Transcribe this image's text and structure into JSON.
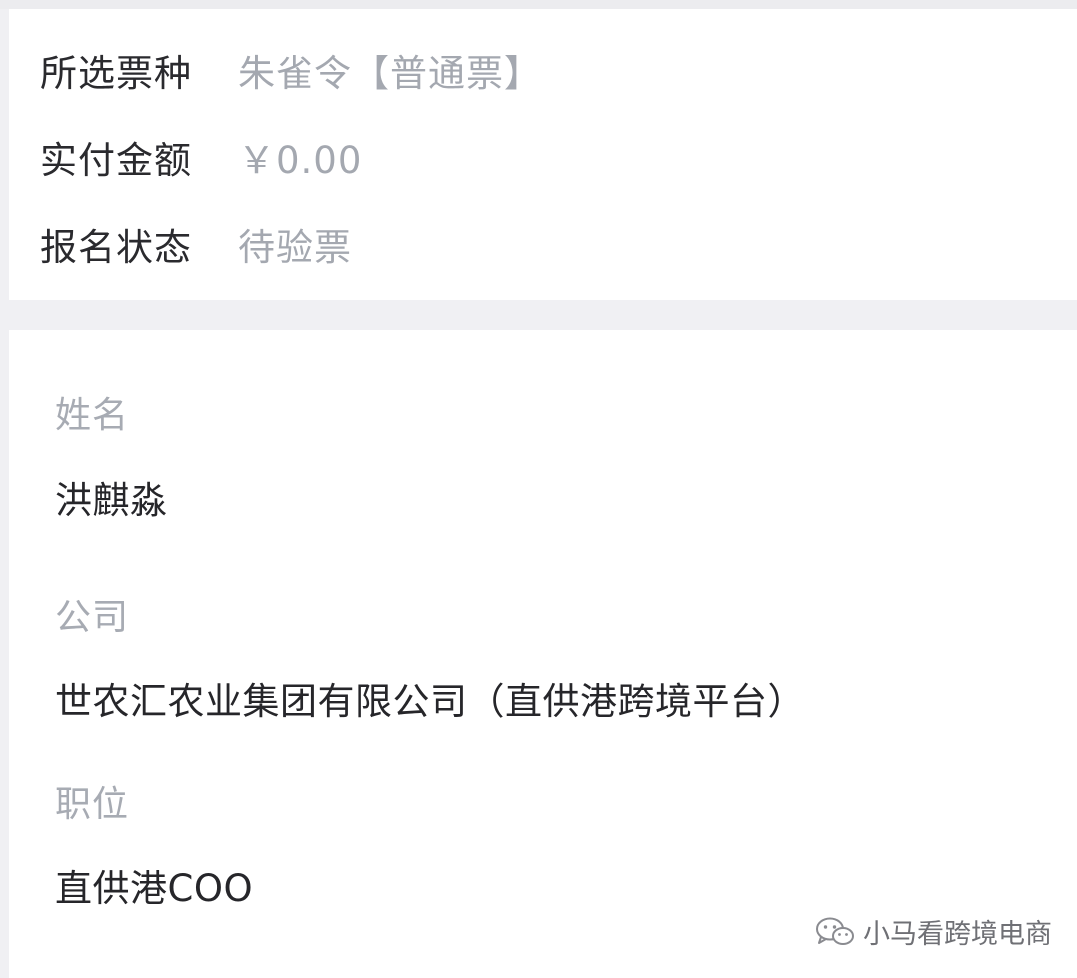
{
  "summary": {
    "ticket_type_label": "所选票种",
    "ticket_type_value": "朱雀令【普通票】",
    "amount_label": "实付金额",
    "amount_value": "￥0.00",
    "status_label": "报名状态",
    "status_value": "待验票"
  },
  "form": {
    "name_label": "姓名",
    "name_value": "洪麒淼",
    "company_label": "公司",
    "company_value": "世农汇农业集团有限公司（直供港跨境平台）",
    "position_label": "职位",
    "position_value": "直供港COO"
  },
  "watermark": {
    "text": "小马看跨境电商",
    "icon": "wechat-icon"
  }
}
